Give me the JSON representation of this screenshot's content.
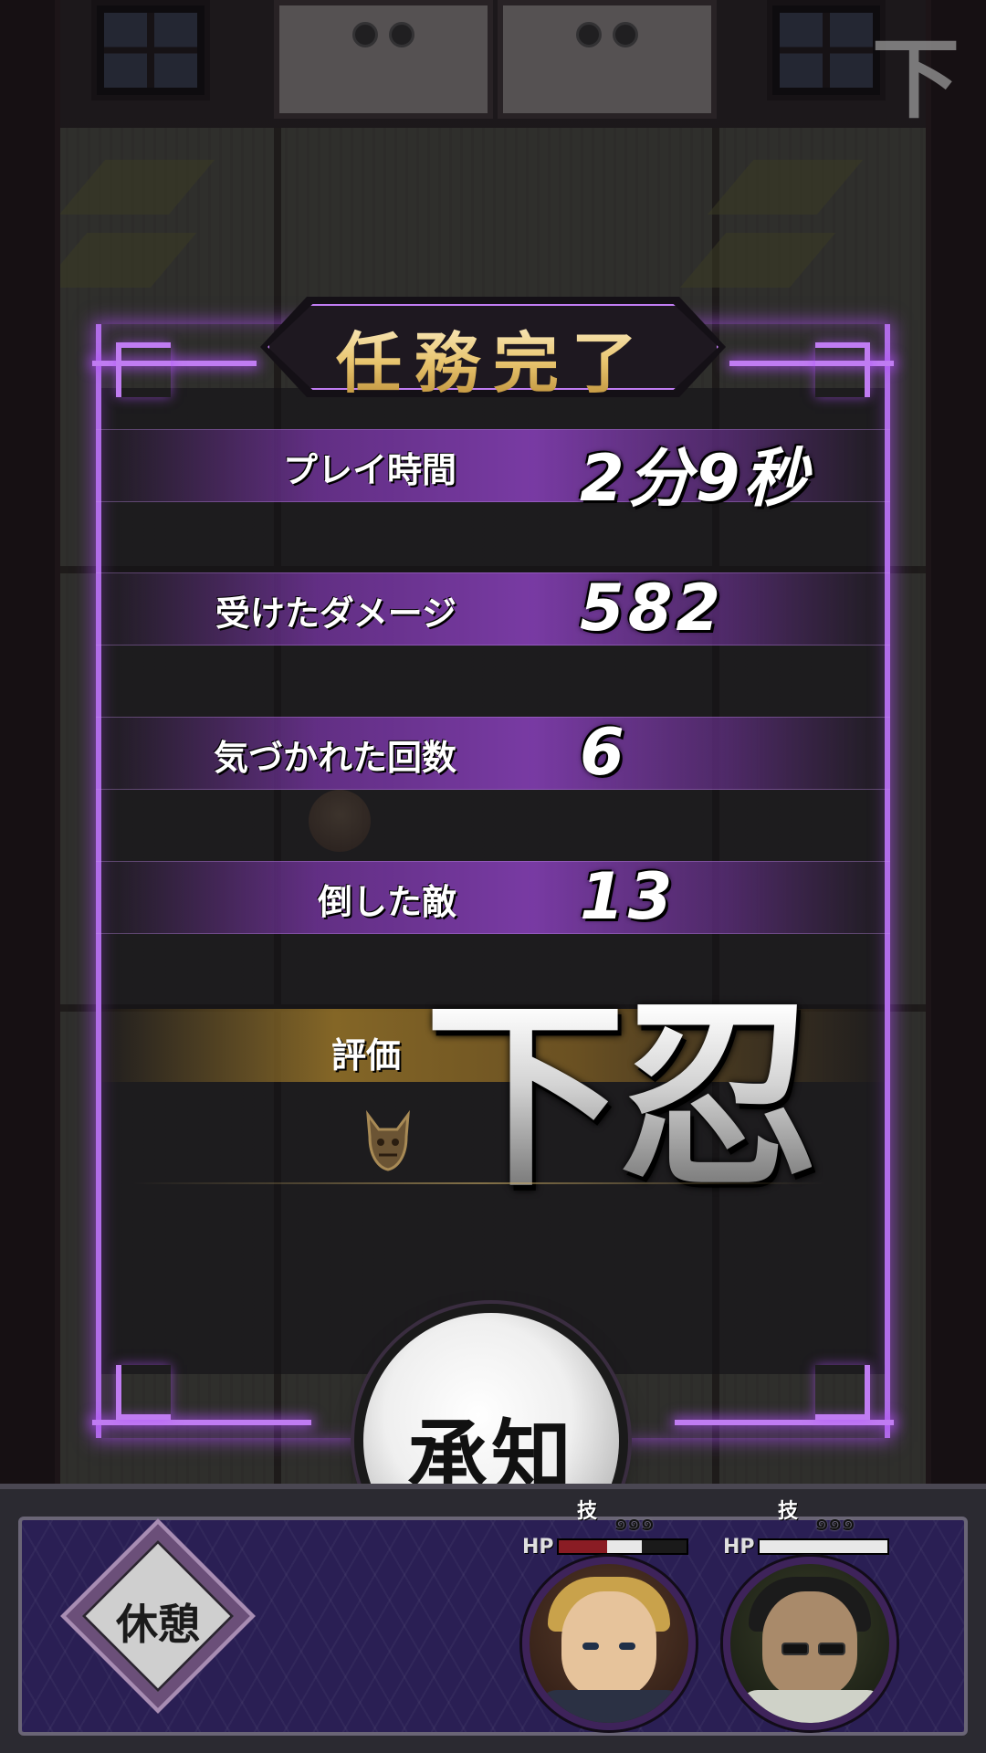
{
  "corner_logo": "下",
  "result": {
    "title": "任務完了",
    "stats": [
      {
        "label": "プレイ時間",
        "value": "2分9秒"
      },
      {
        "label": "受けたダメージ",
        "value": "582"
      },
      {
        "label": "気づかれた回数",
        "value": "6"
      },
      {
        "label": "倒した敵",
        "value": "13"
      }
    ],
    "rank_label": "評価",
    "rank_value": "下忍"
  },
  "accept_button": "承知",
  "hud": {
    "rest_button": "休憩",
    "characters": [
      {
        "skill_label": "技",
        "hp_label": "HP",
        "hp_fraction": 0.65
      },
      {
        "skill_label": "技",
        "hp_label": "HP",
        "hp_fraction": 1.0
      }
    ]
  },
  "colors": {
    "panel_glow": "#b06ce8",
    "stat_band": "#7d3caa",
    "rank_band": "#96732a",
    "hud_bg": "#2a1f54"
  }
}
